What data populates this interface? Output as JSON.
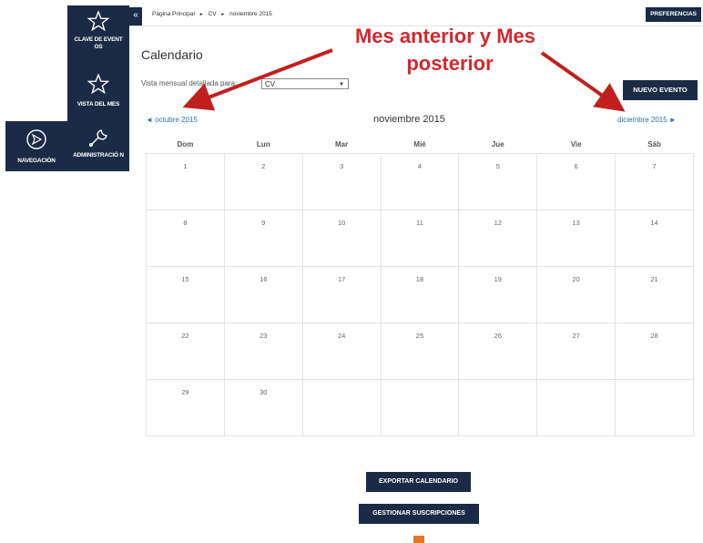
{
  "sidebar": {
    "items": [
      {
        "label": "CLAVE DE EVENT OS",
        "icon": "star-icon"
      },
      {
        "label": "VISTA DEL MES",
        "icon": "star-icon"
      },
      {
        "label": "NAVEGACIÓN",
        "icon": "navigation-icon"
      },
      {
        "label": "ADMINISTRACIÓ N",
        "icon": "wrench-icon"
      }
    ],
    "collapse_label": "«"
  },
  "breadcrumb": {
    "home": "Página Principal",
    "sep": "►",
    "course": "CV",
    "current": "noviembre 2015"
  },
  "header": {
    "preferences_label": "PREFERENCIAS"
  },
  "page": {
    "title": "Calendario"
  },
  "view": {
    "label": "Vista mensual detallada para:",
    "select_value": "CV",
    "select_arrow": "▼"
  },
  "new_event_label": "NUEVO EVENTO",
  "nav": {
    "prev": "◄ octubre 2015",
    "current": "noviembre 2015",
    "next": "diciembre 2015 ►"
  },
  "calendar": {
    "weekdays": [
      "Dom",
      "Lun",
      "Mar",
      "Mié",
      "Jue",
      "Vie",
      "Sáb"
    ],
    "weeks": [
      [
        "1",
        "2",
        "3",
        "4",
        "5",
        "6",
        "7"
      ],
      [
        "8",
        "9",
        "10",
        "11",
        "12",
        "13",
        "14"
      ],
      [
        "15",
        "16",
        "17",
        "18",
        "19",
        "20",
        "21"
      ],
      [
        "22",
        "23",
        "24",
        "25",
        "26",
        "27",
        "28"
      ],
      [
        "29",
        "30",
        "",
        "",
        "",
        "",
        ""
      ]
    ]
  },
  "actions": {
    "export": "EXPORTAR CALENDARIO",
    "subscriptions": "GESTIONAR SUSCRIPCIONES"
  },
  "annotation": {
    "line1": "Mes anterior y Mes",
    "line2": "posterior",
    "color": "#d2282e"
  },
  "colors": {
    "navy": "#1b2a47",
    "link": "#2a6fb8"
  }
}
